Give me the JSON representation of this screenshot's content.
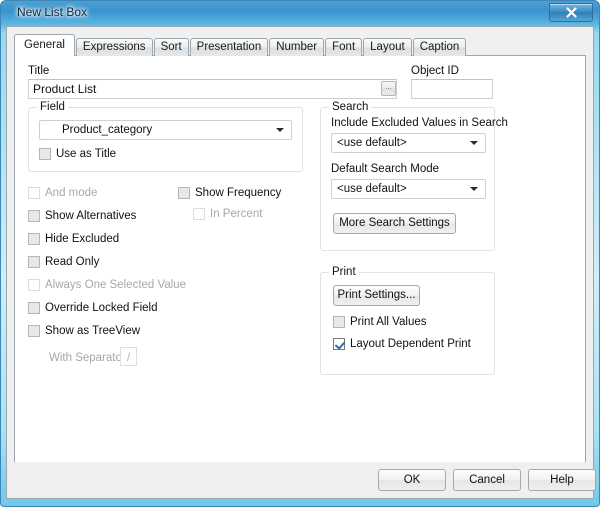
{
  "window": {
    "title": "New List Box",
    "close_label": "x"
  },
  "tabs": [
    {
      "label": "General",
      "active": true
    },
    {
      "label": "Expressions",
      "active": false
    },
    {
      "label": "Sort",
      "active": false
    },
    {
      "label": "Presentation",
      "active": false
    },
    {
      "label": "Number",
      "active": false
    },
    {
      "label": "Font",
      "active": false
    },
    {
      "label": "Layout",
      "active": false
    },
    {
      "label": "Caption",
      "active": false
    }
  ],
  "general": {
    "title_label": "Title",
    "title_value": "Product List",
    "title_browse_label": "...",
    "object_id_label": "Object ID",
    "object_id_value": "",
    "field_group_label": "Field",
    "field_value": "Product_category",
    "use_as_title_label": "Use as Title",
    "checkboxes": [
      {
        "label": "And mode",
        "checked": false,
        "enabled": false
      },
      {
        "label": "Show Alternatives",
        "checked": false,
        "enabled": true
      },
      {
        "label": "Hide Excluded",
        "checked": false,
        "enabled": true
      },
      {
        "label": "Read Only",
        "checked": false,
        "enabled": true
      },
      {
        "label": "Always One Selected Value",
        "checked": false,
        "enabled": false
      },
      {
        "label": "Override Locked Field",
        "checked": false,
        "enabled": true
      },
      {
        "label": "Show as TreeView",
        "checked": false,
        "enabled": true
      }
    ],
    "show_frequency_label": "Show Frequency",
    "in_percent_label": "In Percent",
    "with_separator_label": "With Separator",
    "separator_value": "/"
  },
  "search": {
    "group_label": "Search",
    "include_excluded_label": "Include Excluded Values in Search",
    "include_excluded_value": "<use default>",
    "default_search_mode_label": "Default Search Mode",
    "default_search_mode_value": "<use default>",
    "more_settings_label": "More Search Settings"
  },
  "print": {
    "group_label": "Print",
    "print_settings_label": "Print Settings...",
    "print_all_values_label": "Print All Values",
    "layout_dependent_label": "Layout Dependent Print"
  },
  "footer": {
    "ok_label": "OK",
    "cancel_label": "Cancel",
    "help_label": "Help"
  },
  "colors": {
    "accent": "#3c8fc4",
    "check": "#2c6fa8",
    "panel": "#ffffff",
    "dialog": "#f0f0f0"
  }
}
